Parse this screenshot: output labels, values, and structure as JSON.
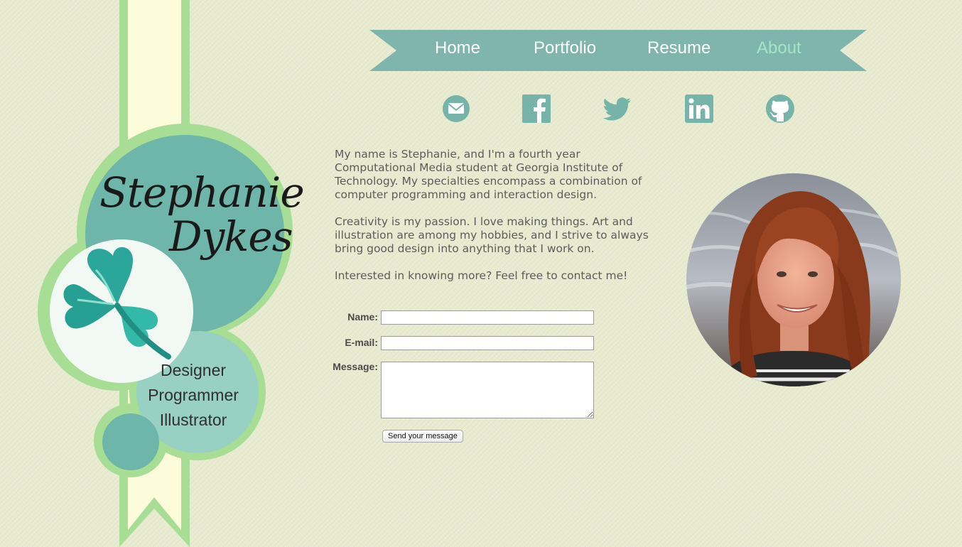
{
  "badge": {
    "first_name": "Stephanie",
    "last_name": "Dykes",
    "roles": [
      "Designer",
      "Programmer",
      "Illustrator"
    ],
    "logo_icon": "clover-icon",
    "colors": {
      "ribbon": "#fdfcda",
      "ribbon_border": "#a8dd95",
      "circle_main": "#6db6a9",
      "circle_light": "#98d0c4",
      "circle_white": "#f2f8f4",
      "clover": "#2aa79a"
    }
  },
  "nav": {
    "items": [
      {
        "label": "Home",
        "active": false
      },
      {
        "label": "Portfolio",
        "active": false
      },
      {
        "label": "Resume",
        "active": false
      },
      {
        "label": "About",
        "active": true
      }
    ],
    "colors": {
      "banner": "#7fb5ac",
      "text": "#ffffff",
      "active_text": "#a4e6c4"
    }
  },
  "social": [
    {
      "name": "email",
      "icon": "email-icon"
    },
    {
      "name": "facebook",
      "icon": "facebook-icon"
    },
    {
      "name": "twitter",
      "icon": "twitter-icon"
    },
    {
      "name": "linkedin",
      "icon": "linkedin-icon"
    },
    {
      "name": "github",
      "icon": "github-icon"
    }
  ],
  "about": {
    "paragraphs": [
      "My name is Stephanie, and I'm a fourth year Computational Media student at Georgia Institute of Technology. My specialties encompass a combination of computer programming and interaction design.",
      "Creativity is my passion. I love making things. Art and illustration are among my hobbies, and I strive to always bring good design into anything that I work on.",
      "Interested in knowing more? Feel free to contact me!"
    ]
  },
  "form": {
    "name_label": "Name:",
    "name_value": "",
    "email_label": "E-mail:",
    "email_value": "",
    "message_label": "Message:",
    "message_value": "",
    "submit_label": "Send your message"
  },
  "photo": {
    "subject": "portrait-photo"
  }
}
